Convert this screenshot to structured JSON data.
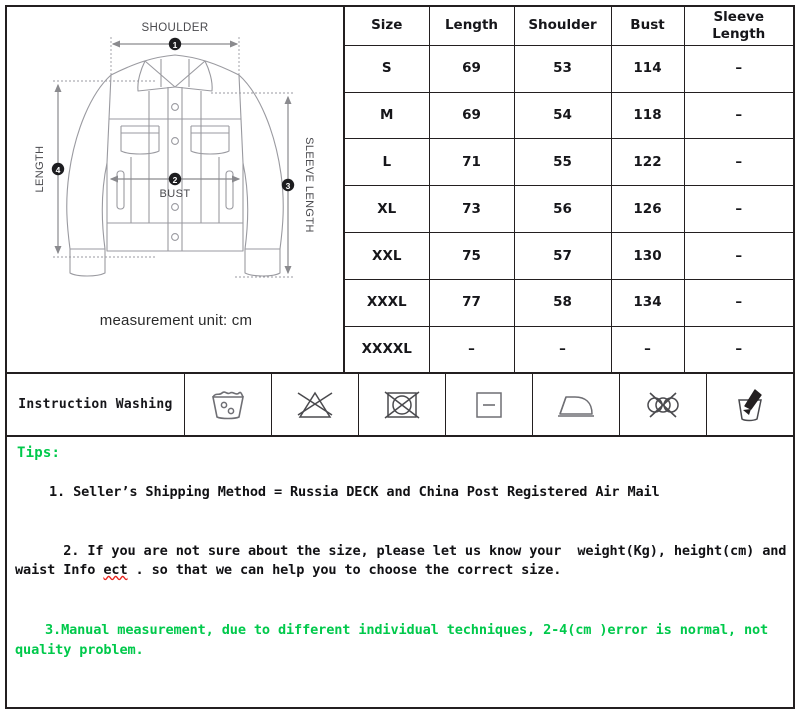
{
  "diagram": {
    "caption": "measurement unit: cm",
    "labels": {
      "shoulder": "SHOULDER",
      "bust": "BUST",
      "length": "LENGTH",
      "sleeve_length": "SLEEVE LENGTH"
    },
    "markers": {
      "shoulder": "1",
      "bust": "2",
      "sleeve_length": "3",
      "length": "4"
    },
    "garment": "denim-jacket"
  },
  "size_table": {
    "headers": [
      "Size",
      "Length",
      "Shoulder",
      "Bust",
      "Sleeve Length"
    ],
    "rows": [
      {
        "size": "S",
        "length": "69",
        "shoulder": "53",
        "bust": "114",
        "sleeve": "–"
      },
      {
        "size": "M",
        "length": "69",
        "shoulder": "54",
        "bust": "118",
        "sleeve": "–"
      },
      {
        "size": "L",
        "length": "71",
        "shoulder": "55",
        "bust": "122",
        "sleeve": "–"
      },
      {
        "size": "XL",
        "length": "73",
        "shoulder": "56",
        "bust": "126",
        "sleeve": "–"
      },
      {
        "size": "XXL",
        "length": "75",
        "shoulder": "57",
        "bust": "130",
        "sleeve": "–"
      },
      {
        "size": "XXXL",
        "length": "77",
        "shoulder": "58",
        "bust": "134",
        "sleeve": "–"
      },
      {
        "size": "XXXXL",
        "length": "–",
        "shoulder": "–",
        "bust": "–",
        "sleeve": "–"
      }
    ]
  },
  "washing": {
    "label": "Instruction Washing",
    "icons": [
      "machine-wash-tub-icon",
      "do-not-bleach-icon",
      "do-not-tumble-dry-icon",
      "dry-flat-icon",
      "iron-icon",
      "do-not-dry-clean-icon",
      "hand-wash-brush-icon"
    ]
  },
  "tips": {
    "heading": "Tips:",
    "line1": "1. Seller’s Shipping Method = Russia DECK and China Post Registered Air Mail",
    "line2_a": "2. If you are not sure about the size, please let us know your  weight(Kg), height(cm) and waist Info ",
    "line2_misspelled": "ect",
    "line2_b": " . so that we can help you to choose the correct size.",
    "line3": "3.Manual measurement, due to different individual techniques, 2-4(cm )error is normal, not quality problem."
  },
  "colors": {
    "tips_green": "#00c94b",
    "text_black": "#111114",
    "border": "#231f20",
    "spellcheck_red": "#e8251f",
    "diagram_gray": "#8a8a8e"
  }
}
